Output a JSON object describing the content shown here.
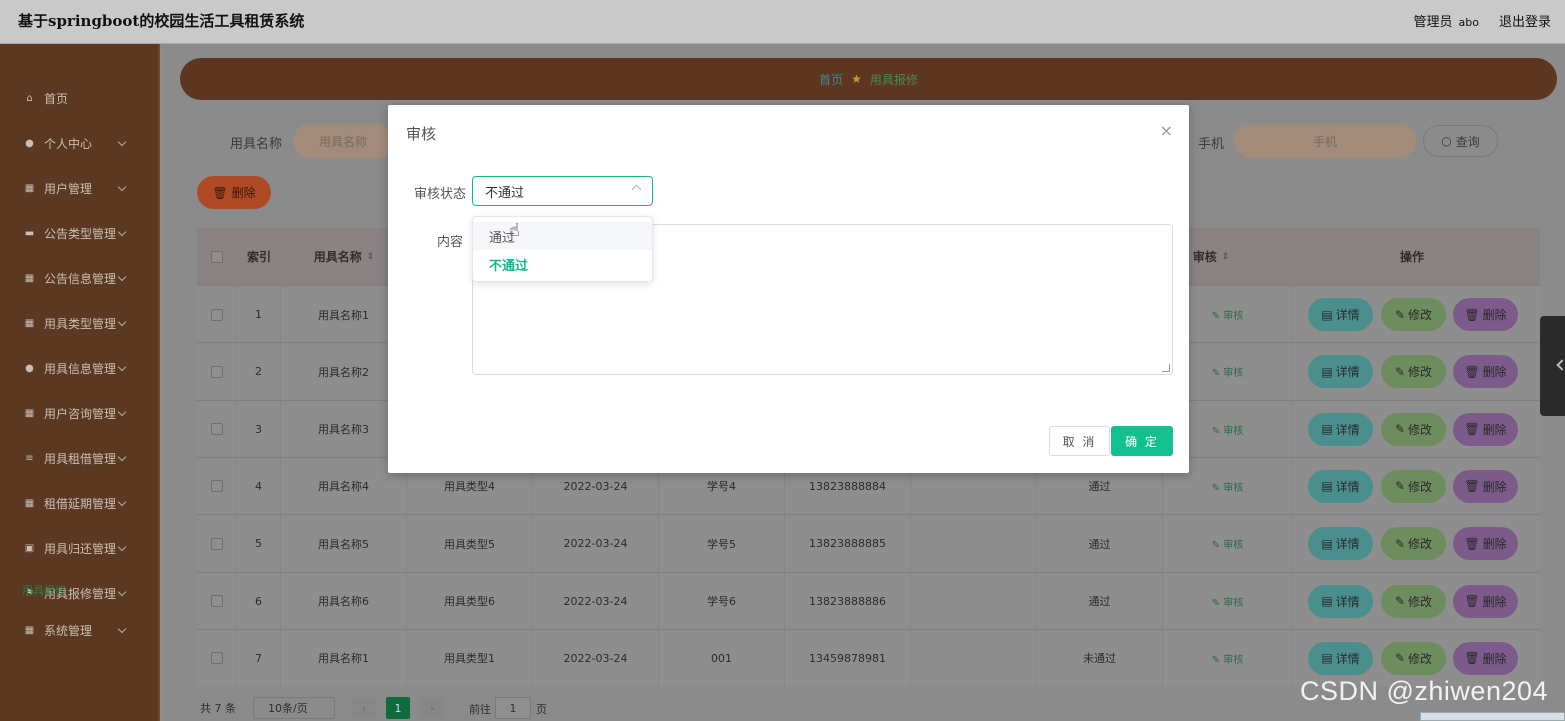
{
  "header": {
    "title": "基于springboot的校园生活工具租赁系统",
    "role": "管理员",
    "user": "abo",
    "logout": "退出登录"
  },
  "sidebar": {
    "items": [
      {
        "label": "首页",
        "icon": "home-icon"
      },
      {
        "label": "个人中心",
        "icon": "person-icon"
      },
      {
        "label": "用户管理",
        "icon": "grid-icon"
      },
      {
        "label": "公告类型管理",
        "icon": "ticket-icon"
      },
      {
        "label": "公告信息管理",
        "icon": "grid-icon"
      },
      {
        "label": "用具类型管理",
        "icon": "grid-icon"
      },
      {
        "label": "用具信息管理",
        "icon": "person-icon"
      },
      {
        "label": "用户咨询管理",
        "icon": "grid-icon"
      },
      {
        "label": "用具租借管理",
        "icon": "list-icon"
      },
      {
        "label": "租借延期管理",
        "icon": "grid-icon"
      },
      {
        "label": "用具归还管理",
        "icon": "lock-icon"
      },
      {
        "label": "用具报修管理",
        "icon": "flag-icon"
      },
      {
        "label": "系统管理",
        "icon": "grid-icon"
      }
    ],
    "active_sub": "用具报修"
  },
  "breadcrumb": {
    "home": "首页",
    "current": "用具报修"
  },
  "search": {
    "name_label": "用具名称",
    "name_placeholder": "用具名称",
    "phone_label": "手机",
    "phone_placeholder": "手机",
    "query": "查询"
  },
  "toolbar": {
    "delete": "删除"
  },
  "table": {
    "headers": [
      "索引",
      "用具名称",
      "审核",
      "操作"
    ],
    "rows": [
      {
        "index": "1",
        "name": "用具名称1",
        "type": "",
        "date": "",
        "sid": "",
        "phone": "",
        "status": "",
        "audit": "审核"
      },
      {
        "index": "2",
        "name": "用具名称2",
        "type": "",
        "date": "",
        "sid": "",
        "phone": "",
        "status": "",
        "audit": "审核"
      },
      {
        "index": "3",
        "name": "用具名称3",
        "type": "",
        "date": "",
        "sid": "",
        "phone": "",
        "status": "",
        "audit": "审核"
      },
      {
        "index": "4",
        "name": "用具名称4",
        "type": "用具类型4",
        "date": "2022-03-24",
        "sid": "学号4",
        "phone": "13823888884",
        "status": "通过",
        "audit": "审核"
      },
      {
        "index": "5",
        "name": "用具名称5",
        "type": "用具类型5",
        "date": "2022-03-24",
        "sid": "学号5",
        "phone": "13823888885",
        "status": "通过",
        "audit": "审核"
      },
      {
        "index": "6",
        "name": "用具名称6",
        "type": "用具类型6",
        "date": "2022-03-24",
        "sid": "学号6",
        "phone": "13823888886",
        "status": "通过",
        "audit": "审核"
      },
      {
        "index": "7",
        "name": "用具名称1",
        "type": "用具类型1",
        "date": "2022-03-24",
        "sid": "001",
        "phone": "13459878981",
        "status": "未通过",
        "audit": "审核"
      }
    ],
    "actions": {
      "detail": "详情",
      "edit": "修改",
      "delete": "删除"
    }
  },
  "pagination": {
    "total_prefix": "共",
    "total": "7",
    "total_suffix": "条",
    "page_size": "10条/页",
    "current_page": "1",
    "goto_label": "前往",
    "goto_value": "1",
    "page_suffix": "页"
  },
  "dialog": {
    "title": "审核",
    "status_label": "审核状态",
    "status_value": "不通过",
    "content_label": "内容",
    "options": [
      "通过",
      "不通过"
    ],
    "cancel": "取 消",
    "confirm": "确 定"
  },
  "watermark": "CSDN @zhiwen204",
  "colors": {
    "accent": "#13c08f",
    "sidebar": "#5a3821",
    "brand": "#5c3620"
  }
}
